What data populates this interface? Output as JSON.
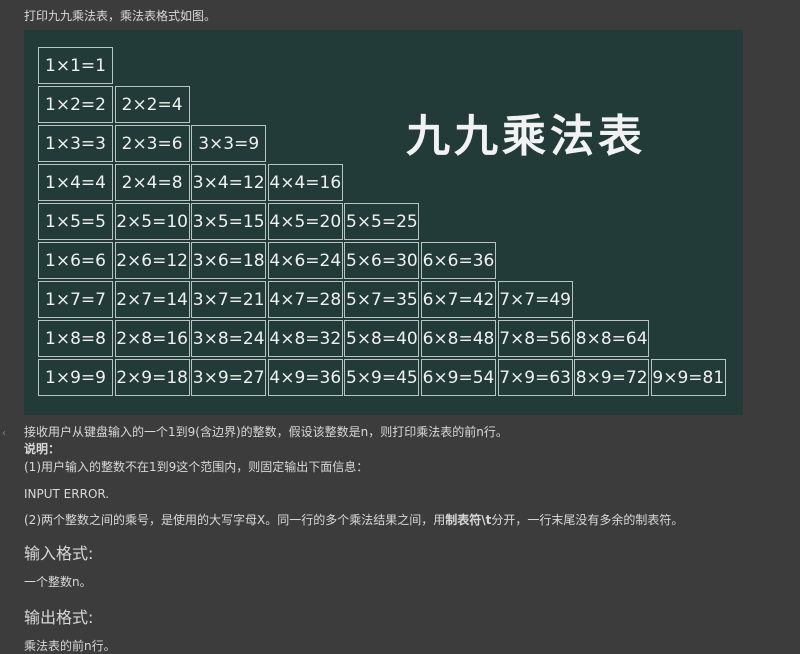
{
  "intro": "打印九九乘法表，乘法表格式如图。",
  "board": {
    "title": "九九乘法表",
    "rows": [
      [
        "1×1=1"
      ],
      [
        "1×2=2",
        "2×2=4"
      ],
      [
        "1×3=3",
        "2×3=6",
        "3×3=9"
      ],
      [
        "1×4=4",
        "2×4=8",
        "3×4=12",
        "4×4=16"
      ],
      [
        "1×5=5",
        "2×5=10",
        "3×5=15",
        "4×5=20",
        "5×5=25"
      ],
      [
        "1×6=6",
        "2×6=12",
        "3×6=18",
        "4×6=24",
        "5×6=30",
        "6×6=36"
      ],
      [
        "1×7=7",
        "2×7=14",
        "3×7=21",
        "4×7=28",
        "5×7=35",
        "6×7=42",
        "7×7=49"
      ],
      [
        "1×8=8",
        "2×8=16",
        "3×8=24",
        "4×8=32",
        "5×8=40",
        "6×8=48",
        "7×8=56",
        "8×8=64"
      ],
      [
        "1×9=9",
        "2×9=18",
        "3×9=27",
        "4×9=36",
        "5×9=45",
        "6×9=54",
        "7×9=63",
        "8×9=72",
        "9×9=81"
      ]
    ]
  },
  "description": "接收用户从键盘输入的一个1到9(含边界)的整数，假设该整数是n，则打印乘法表的前n行。",
  "note_label": "说明：",
  "note1": "(1)用户输入的整数不在1到9这个范围内，则固定输出下面信息：",
  "error_text": "INPUT ERROR.",
  "note2_pre": "(2)两个整数之间的乘号，是使用的大写字母X。同一行的多个乘法结果之间，用",
  "note2_bold": "制表符\\t",
  "note2_post": "分开，一行末尾没有多余的制表符。",
  "input_heading": "输入格式:",
  "input_text": "一个整数n。",
  "output_heading": "输出格式:",
  "output_text": "乘法表的前n行。",
  "side_icon": "chevron-left-icon"
}
